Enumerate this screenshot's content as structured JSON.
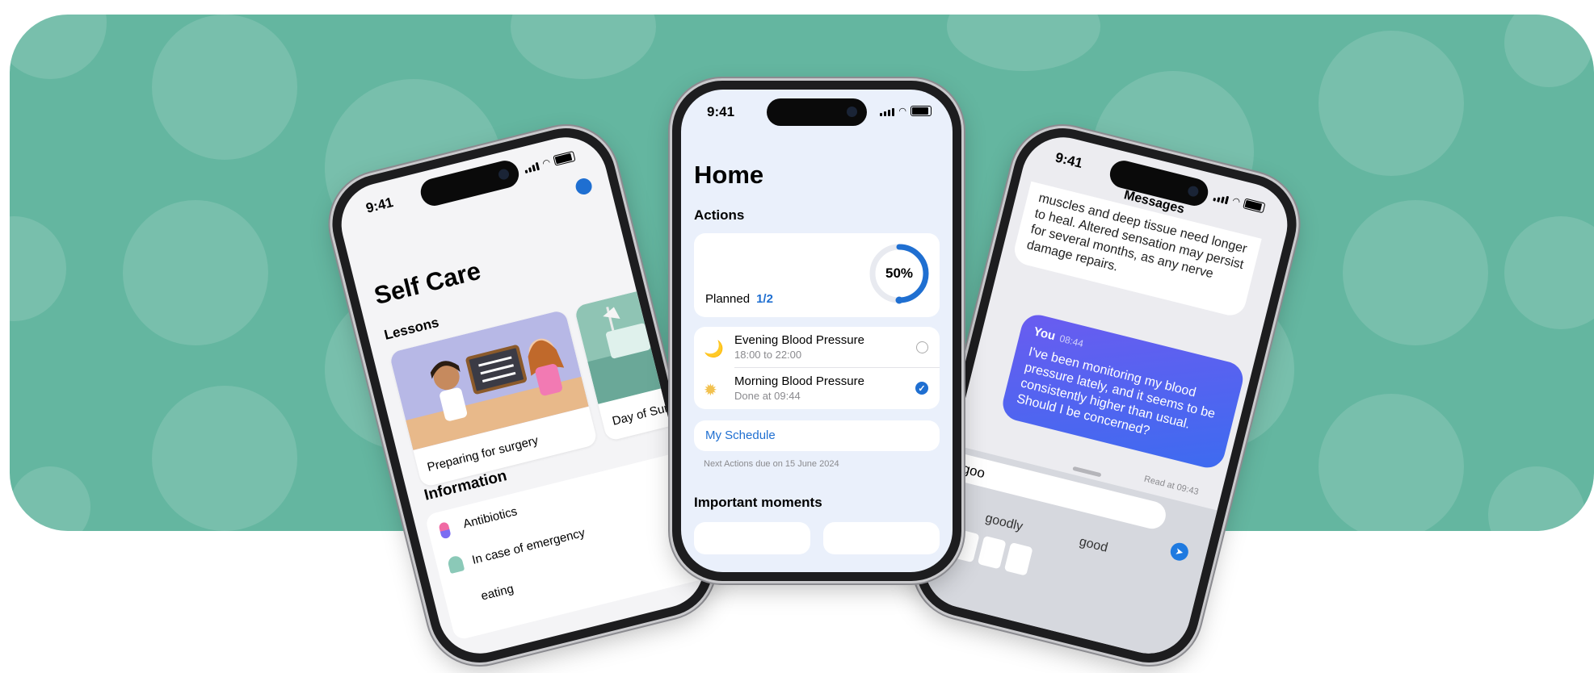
{
  "status": {
    "time": "9:41"
  },
  "left_phone": {
    "title": "Self Care",
    "lessons_heading": "Lessons",
    "lessons": [
      {
        "label": "Preparing for surgery"
      },
      {
        "label": "Day of Surg"
      }
    ],
    "information_heading": "Information",
    "information_items": [
      {
        "label": "Antibiotics",
        "icon": "pill-icon"
      },
      {
        "label": "In case of emergency",
        "icon": "emergency-icon"
      },
      {
        "label": "eating",
        "icon": "eating-icon"
      }
    ]
  },
  "center_phone": {
    "title": "Home",
    "actions_heading": "Actions",
    "progress": {
      "value": 0.5,
      "label": "50%"
    },
    "planned_label": "Planned",
    "planned_count": "1/2",
    "tasks": [
      {
        "name": "Evening Blood Pressure",
        "detail": "18:00 to 22:00",
        "icon": "moon-icon",
        "done": false
      },
      {
        "name": "Morning Blood Pressure",
        "detail": "Done at 09:44",
        "icon": "sun-icon",
        "done": true
      }
    ],
    "schedule_link": "My Schedule",
    "next_actions": "Next Actions due on 15 June 2024",
    "important_heading": "Important moments"
  },
  "right_phone": {
    "nav_title": "Messages",
    "incoming_text": "muscles and deep tissue need longer to heal. Altered sensation may persist for several months, as any nerve damage repairs.",
    "outgoing": {
      "sender": "You",
      "time": "08:44",
      "text": "I've been monitoring my blood pressure lately, and it seems to be consistently higher than usual. Should I be concerned?"
    },
    "read_receipt": "Read at 09:43",
    "compose_value": "ing goo",
    "suggestions": [
      "goodly",
      "good"
    ]
  },
  "colors": {
    "background": "#64b6a0",
    "accent": "#1f6fd1",
    "outgoing_bubble_start": "#6a5cf0",
    "outgoing_bubble_end": "#3d6bf0"
  }
}
